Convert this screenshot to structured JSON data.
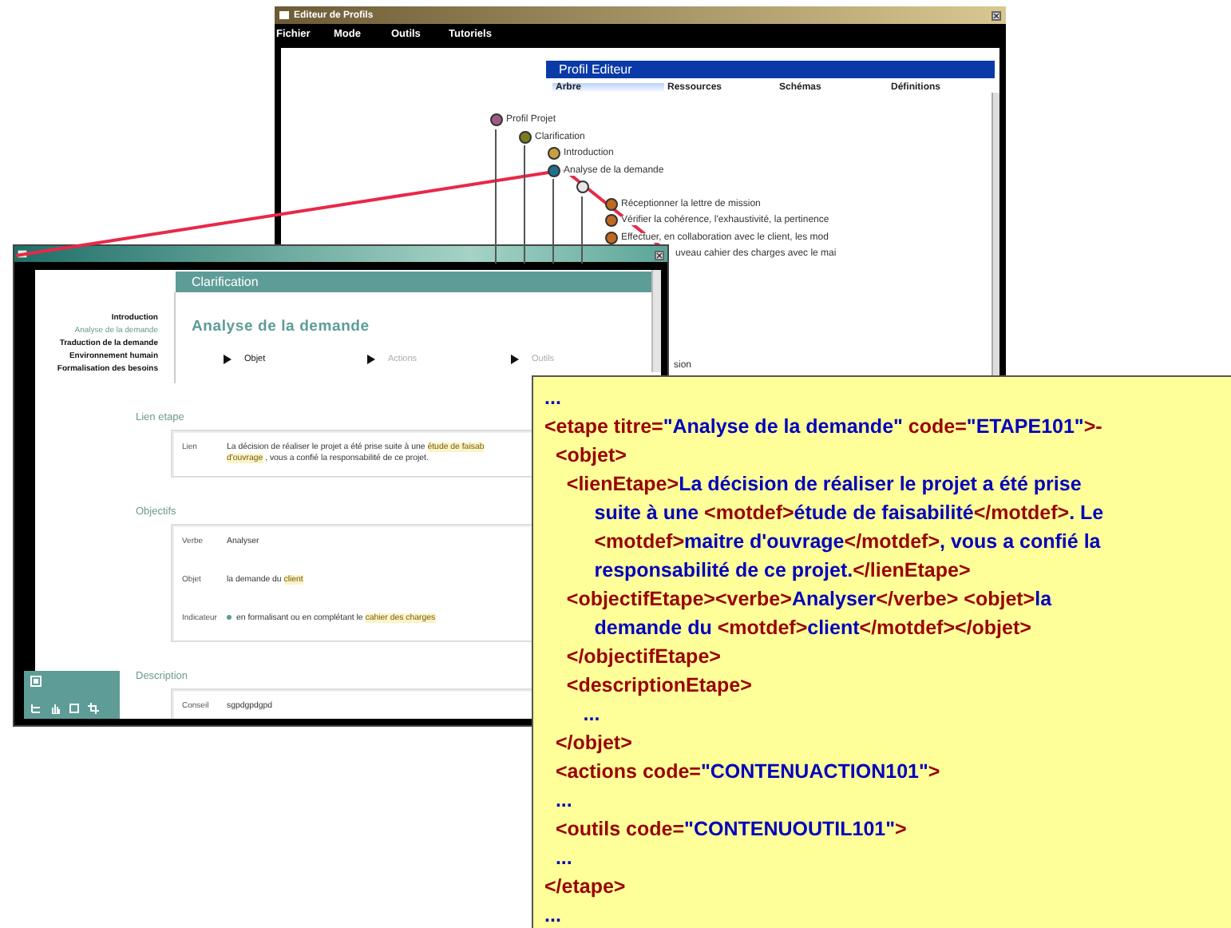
{
  "profile_editor_window": {
    "title": "Editeur de Profils",
    "menu": [
      "Fichier",
      "Mode",
      "Outils",
      "Tutoriels"
    ],
    "header": "Profil Editeur",
    "tabs": [
      {
        "label": "Arbre",
        "selected": true
      },
      {
        "label": "Ressources",
        "selected": false
      },
      {
        "label": "Schémas",
        "selected": false
      },
      {
        "label": "Définitions",
        "selected": false
      }
    ],
    "tree": [
      {
        "label": "Profil Projet",
        "color": "#a05a80",
        "children": [
          {
            "label": "Clarification",
            "color": "#7a7a20",
            "children": [
              {
                "label": "Introduction",
                "color": "#c8a040"
              },
              {
                "label": "Analyse de la demande",
                "color": "#1f6f8f",
                "children": [
                  {
                    "color": "#e6e6e6",
                    "children": [
                      {
                        "label": "Réceptionner la lettre de mission",
                        "color": "#c06a20",
                        "partially_hidden": false
                      },
                      {
                        "label": "Vérifier la cohérence, l'exhaustivité, la pertinence",
                        "color": "#c06a20",
                        "partially_hidden": false
                      },
                      {
                        "label": "Effectuer, en collaboration avec le client, les mod",
                        "color": "#c06a20",
                        "partially_hidden": false
                      },
                      {
                        "label": "uveau cahier des charges avec le mai",
                        "partially_hidden": true
                      }
                    ]
                  }
                ]
              }
            ]
          }
        ]
      }
    ],
    "tree_row_fragment": "sion"
  },
  "step_window": {
    "header": "Clarification",
    "nav": [
      {
        "label": "Introduction",
        "selected": false
      },
      {
        "label": "Analyse de la demande",
        "selected": true
      },
      {
        "label": "Traduction de la demande",
        "selected": false
      },
      {
        "label": "Environnement humain",
        "selected": false
      },
      {
        "label": "Formalisation des besoins",
        "selected": false
      }
    ],
    "title": "Analyse de la demande",
    "tabs": [
      {
        "label": "Objet",
        "selected": true
      },
      {
        "label": "Actions",
        "selected": false
      },
      {
        "label": "Outils",
        "selected": false
      }
    ],
    "sections": [
      {
        "title": "Lien etape",
        "rows": [
          {
            "label": "Lien",
            "lines": [
              [
                {
                  "kind": "plain",
                  "text": "La décision de réaliser le projet a été prise suite à une "
                },
                {
                  "kind": "term",
                  "text": "étude de faisab"
                }
              ],
              [
                {
                  "kind": "term",
                  "text": "d'ouvrage"
                },
                {
                  "kind": "plain",
                  "text": " , vous a confié la responsabilité de ce projet."
                }
              ]
            ]
          }
        ]
      },
      {
        "title": "Objectifs",
        "rows": [
          {
            "label": "Verbe",
            "lines": [
              [
                {
                  "kind": "plain",
                  "text": "Analyser"
                }
              ]
            ]
          },
          {
            "label": "Objet",
            "lines": [
              [
                {
                  "kind": "plain",
                  "text": "la demande du "
                },
                {
                  "kind": "term",
                  "text": "client"
                }
              ]
            ]
          },
          {
            "label": "Indicateur",
            "bullet": true,
            "lines": [
              [
                {
                  "kind": "plain",
                  "text": "en formalisant ou en complétant le "
                },
                {
                  "kind": "term",
                  "text": "cahier des charges"
                }
              ]
            ]
          }
        ]
      },
      {
        "title": "Description",
        "rows": [
          {
            "label": "Conseil",
            "lines": [
              [
                {
                  "kind": "plain",
                  "text": "sgpdgpdgpd"
                }
              ]
            ]
          }
        ]
      }
    ]
  },
  "xml_excerpt": {
    "lines": [
      [
        {
          "kind": "text",
          "text": "..."
        }
      ],
      [
        {
          "kind": "tag",
          "text": "<etape titre="
        },
        {
          "kind": "text",
          "text": "\"Analyse de la demande\""
        },
        {
          "kind": "tag",
          "text": " code="
        },
        {
          "kind": "text",
          "text": "\"ETAPE101\""
        },
        {
          "kind": "tag",
          "text": ">-"
        }
      ],
      [
        {
          "kind": "tag",
          "text": "  <objet>"
        }
      ],
      [
        {
          "kind": "tag",
          "text": "    <lienEtape>"
        },
        {
          "kind": "text",
          "text": "La décision de réaliser le projet a été prise"
        }
      ],
      [
        {
          "kind": "text",
          "text": "         suite à une "
        },
        {
          "kind": "tag",
          "text": "<motdef>"
        },
        {
          "kind": "text",
          "text": "étude de faisabilité"
        },
        {
          "kind": "tag",
          "text": "</motdef>"
        },
        {
          "kind": "text",
          "text": ". Le"
        }
      ],
      [
        {
          "kind": "tag",
          "text": "         <motdef>"
        },
        {
          "kind": "text",
          "text": "maitre d'ouvrage"
        },
        {
          "kind": "tag",
          "text": "</motdef>"
        },
        {
          "kind": "text",
          "text": ", vous a confié la"
        }
      ],
      [
        {
          "kind": "text",
          "text": "         responsabilité de ce projet."
        },
        {
          "kind": "tag",
          "text": "</lienEtape>"
        }
      ],
      [
        {
          "kind": "tag",
          "text": "    <objectifEtape><verbe>"
        },
        {
          "kind": "text",
          "text": "Analyser"
        },
        {
          "kind": "tag",
          "text": "</verbe> <objet>"
        },
        {
          "kind": "text",
          "text": "la"
        }
      ],
      [
        {
          "kind": "text",
          "text": "         demande du "
        },
        {
          "kind": "tag",
          "text": "<motdef>"
        },
        {
          "kind": "text",
          "text": "client"
        },
        {
          "kind": "tag",
          "text": "</motdef></objet>"
        }
      ],
      [
        {
          "kind": "tag",
          "text": "    </objectifEtape>"
        }
      ],
      [
        {
          "kind": "tag",
          "text": "    <descriptionEtape>"
        }
      ],
      [
        {
          "kind": "text",
          "text": "       ..."
        }
      ],
      [
        {
          "kind": "tag",
          "text": "  </objet>"
        }
      ],
      [
        {
          "kind": "tag",
          "text": "  <actions code="
        },
        {
          "kind": "text",
          "text": "\"CONTENUACTION101\""
        },
        {
          "kind": "tag",
          "text": ">"
        }
      ],
      [
        {
          "kind": "text",
          "text": "  ..."
        }
      ],
      [
        {
          "kind": "tag",
          "text": "  <outils code="
        },
        {
          "kind": "text",
          "text": "\"CONTENUOUTIL101\""
        },
        {
          "kind": "tag",
          "text": ">"
        }
      ],
      [
        {
          "kind": "text",
          "text": "  ..."
        }
      ],
      [
        {
          "kind": "tag",
          "text": "</etape>"
        }
      ],
      [
        {
          "kind": "text",
          "text": "..."
        }
      ]
    ]
  }
}
